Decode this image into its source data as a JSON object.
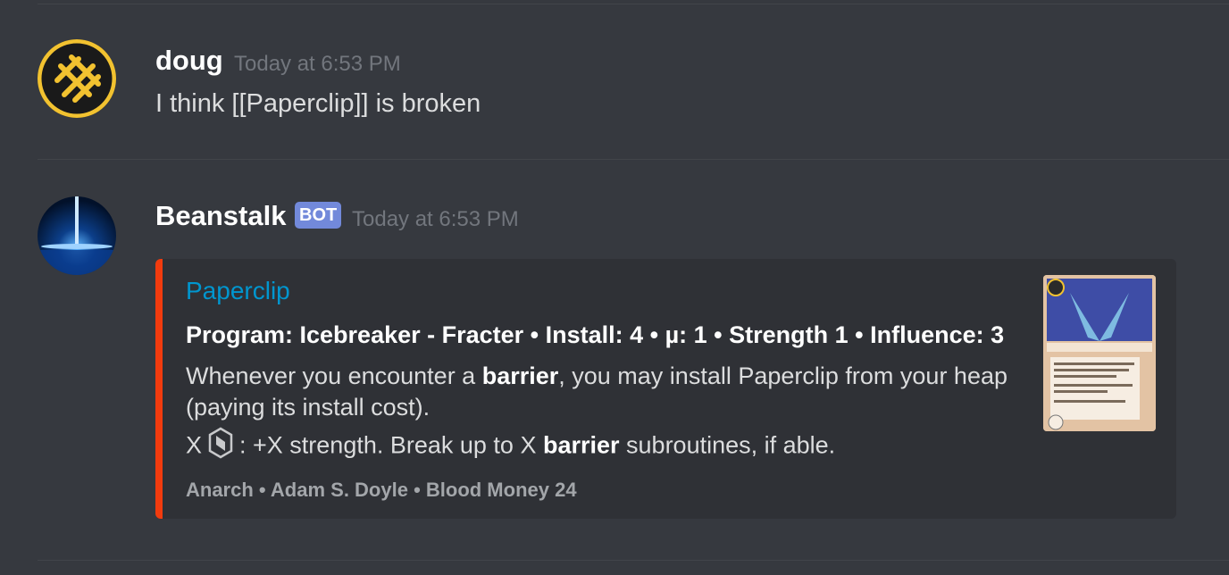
{
  "messages": [
    {
      "username": "doug",
      "timestamp": "Today at 6:53 PM",
      "text": "I think [[Paperclip]] is broken",
      "avatar_icon": "anarch-faction-logo-icon"
    },
    {
      "username": "Beanstalk",
      "bot_badge": "BOT",
      "timestamp": "Today at 6:53 PM",
      "avatar_icon": "beanstalk-space-elevator-icon",
      "embed": {
        "accent_color": "#f23b0e",
        "title": "Paperclip",
        "subtitle": "Program: Icebreaker - Fracter • Install: 4 • µ: 1 • Strength 1 • Influence: 3",
        "desc_line1_a": "Whenever you encounter a ",
        "desc_line1_b": "barrier",
        "desc_line1_c": ", you may install Paperclip from your heap (paying its install cost).",
        "desc_line2_a": "X",
        "desc_line2_icon": "credit-icon",
        "desc_line2_b": ": +X strength. Break up to X ",
        "desc_line2_c": "barrier",
        "desc_line2_d": " subroutines, if able.",
        "footer": "Anarch • Adam S. Doyle • Blood Money 24",
        "thumbnail_icon": "paperclip-card-art-icon"
      }
    }
  ]
}
